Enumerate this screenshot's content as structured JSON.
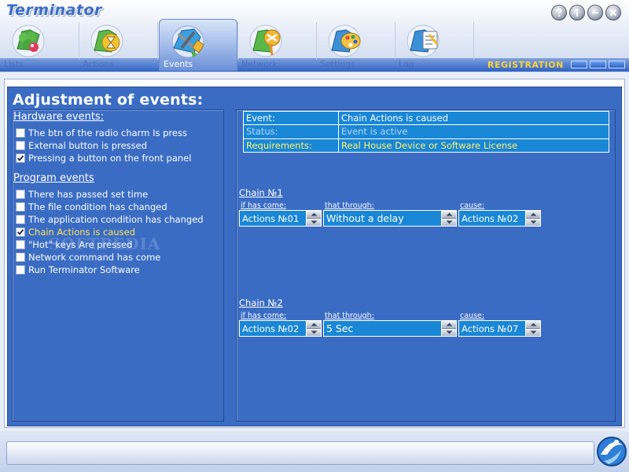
{
  "app": {
    "title": "Terminator"
  },
  "window_controls": [
    "help-icon",
    "info-icon",
    "minimize-icon",
    "close-icon"
  ],
  "tabs": [
    {
      "label": "Lists",
      "icon": "clover-icon"
    },
    {
      "label": "Actions",
      "icon": "hourglass-icon"
    },
    {
      "label": "Events",
      "icon": "tools-icon",
      "active": true
    },
    {
      "label": "Network",
      "icon": "network-icon"
    },
    {
      "label": "Settings",
      "icon": "palette-icon"
    },
    {
      "label": "Log",
      "icon": "notebook-icon"
    }
  ],
  "registration": {
    "label": "REGISTRATION"
  },
  "page": {
    "title": "Adjustment of events:"
  },
  "hardware": {
    "heading": "Hardware events:",
    "items": [
      {
        "label": "The btn of the radio charm Is press",
        "checked": false
      },
      {
        "label": "External button is pressed",
        "checked": false
      },
      {
        "label": "Pressing a button on the front panel",
        "checked": true
      }
    ]
  },
  "program": {
    "heading": "Program events",
    "items": [
      {
        "label": "There has passed set time",
        "checked": false
      },
      {
        "label": "The file condition has changed",
        "checked": false
      },
      {
        "label": "The application condition has changed",
        "checked": false
      },
      {
        "label": "Chain Actions is caused",
        "checked": true,
        "highlight": true
      },
      {
        "label": "\"Hot\" keys Are pressed",
        "checked": false
      },
      {
        "label": "Network command has come",
        "checked": false
      },
      {
        "label": "Run Terminator Software",
        "checked": false
      }
    ]
  },
  "watermark": "SOFTPEDIA",
  "info": {
    "event_key": "Event:",
    "event_val": "Chain Actions is caused",
    "status_key": "Status:",
    "status_val": "Event is active",
    "req_key": "Requirements:",
    "req_val": "Real House Device or Software License"
  },
  "chains": [
    {
      "title": "Chain №1",
      "if_label": "if has come:",
      "through_label": "that through:",
      "cause_label": "cause:",
      "if_val": "Actions №01",
      "through_val": "Without a delay",
      "cause_val": "Actions №02"
    },
    {
      "title": "Chain №2",
      "if_label": "if has come:",
      "through_label": "that through:",
      "cause_label": "cause:",
      "if_val": "Actions №02",
      "through_val": "5 Sec",
      "cause_val": "Actions №07"
    }
  ],
  "colors": {
    "panel_blue": "#3a6cc4",
    "field_blue": "#1a87d6",
    "highlight_yellow": "#fff36a",
    "registration_yellow": "#ffd23a"
  }
}
